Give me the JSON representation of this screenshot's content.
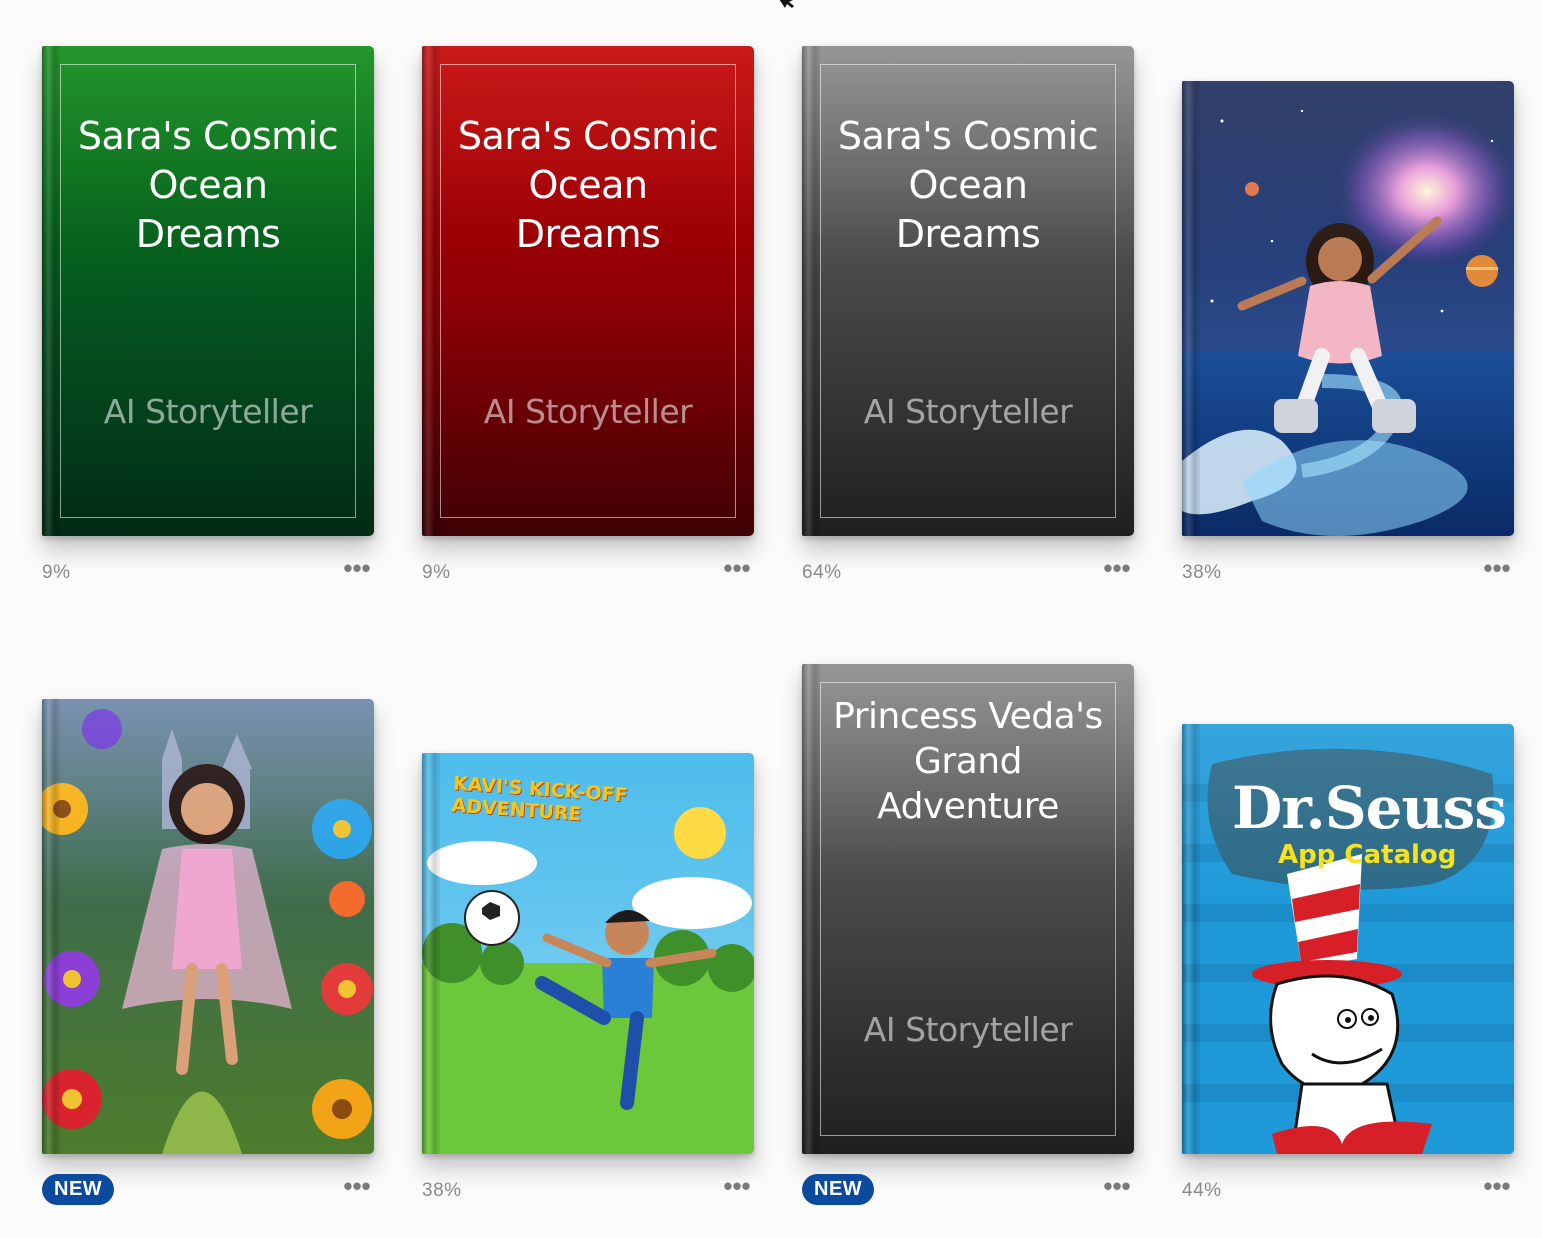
{
  "books": [
    {
      "cover_title": "Sara's Cosmic Ocean Dreams",
      "cover_author": "AI Storyteller",
      "cover_style": "green",
      "progress": "9%",
      "more": "•••"
    },
    {
      "cover_title": "Sara's Cosmic Ocean Dreams",
      "cover_author": "AI Storyteller",
      "cover_style": "red",
      "progress": "9%",
      "more": "•••"
    },
    {
      "cover_title": "Sara's Cosmic Ocean Dreams",
      "cover_author": "AI Storyteller",
      "cover_style": "gray",
      "progress": "64%",
      "more": "•••"
    },
    {
      "cover_art": "girl-in-space-ocean-illustration",
      "progress": "38%",
      "more": "•••"
    },
    {
      "cover_art": "girl-in-flower-garden-illustration",
      "badge": "NEW",
      "more": "•••"
    },
    {
      "cover_title": "KAVI'S KICK-OFF ADVENTURE",
      "cover_art": "boy-kicking-soccer-ball-illustration",
      "progress": "38%",
      "more": "•••"
    },
    {
      "cover_title": "Princess Veda's Grand Adventure",
      "cover_author": "AI Storyteller",
      "cover_style": "gray",
      "badge": "NEW",
      "more": "•••"
    },
    {
      "cover_title": "Dr.Seuss",
      "cover_subtitle": "App Catalog",
      "cover_art": "cat-in-the-hat-illustration",
      "progress": "44%",
      "more": "•••"
    }
  ],
  "colors": {
    "badge_bg": "#0b4a9c",
    "progress_text": "#8a8a8a",
    "background": "#fbfbfb"
  }
}
